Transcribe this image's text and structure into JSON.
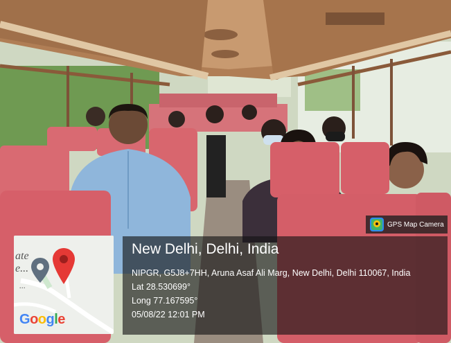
{
  "camera_badge": {
    "label": "GPS Map Camera",
    "icon": "map-pin-camera-icon"
  },
  "map_thumbnail": {
    "fragment_top": "ate",
    "fragment_mid": "e...",
    "fragment_low": "...",
    "logo": {
      "G": "G",
      "o1": "o",
      "o2": "o",
      "g": "g",
      "l": "l",
      "e": "e"
    },
    "logo_colors": {
      "blue": "#4285F4",
      "red": "#EA4335",
      "yellow": "#FBBC05",
      "green": "#34A853"
    },
    "pin_color": "#E53935",
    "secondary_pin_color": "#5F6F7F"
  },
  "location": {
    "title": "New Delhi, Delhi, India",
    "address": "NIPGR, G5J8+7HH, Aruna Asaf Ali Marg, New Delhi, Delhi 110067, India",
    "lat": "Lat 28.530699°",
    "long": "Long 77.167595°",
    "datetime": "05/08/22 12:01 PM"
  },
  "scene": {
    "seat_color": "#d96a72",
    "ceiling_color": "#a9774f",
    "window_color": "#5e8a4a"
  }
}
